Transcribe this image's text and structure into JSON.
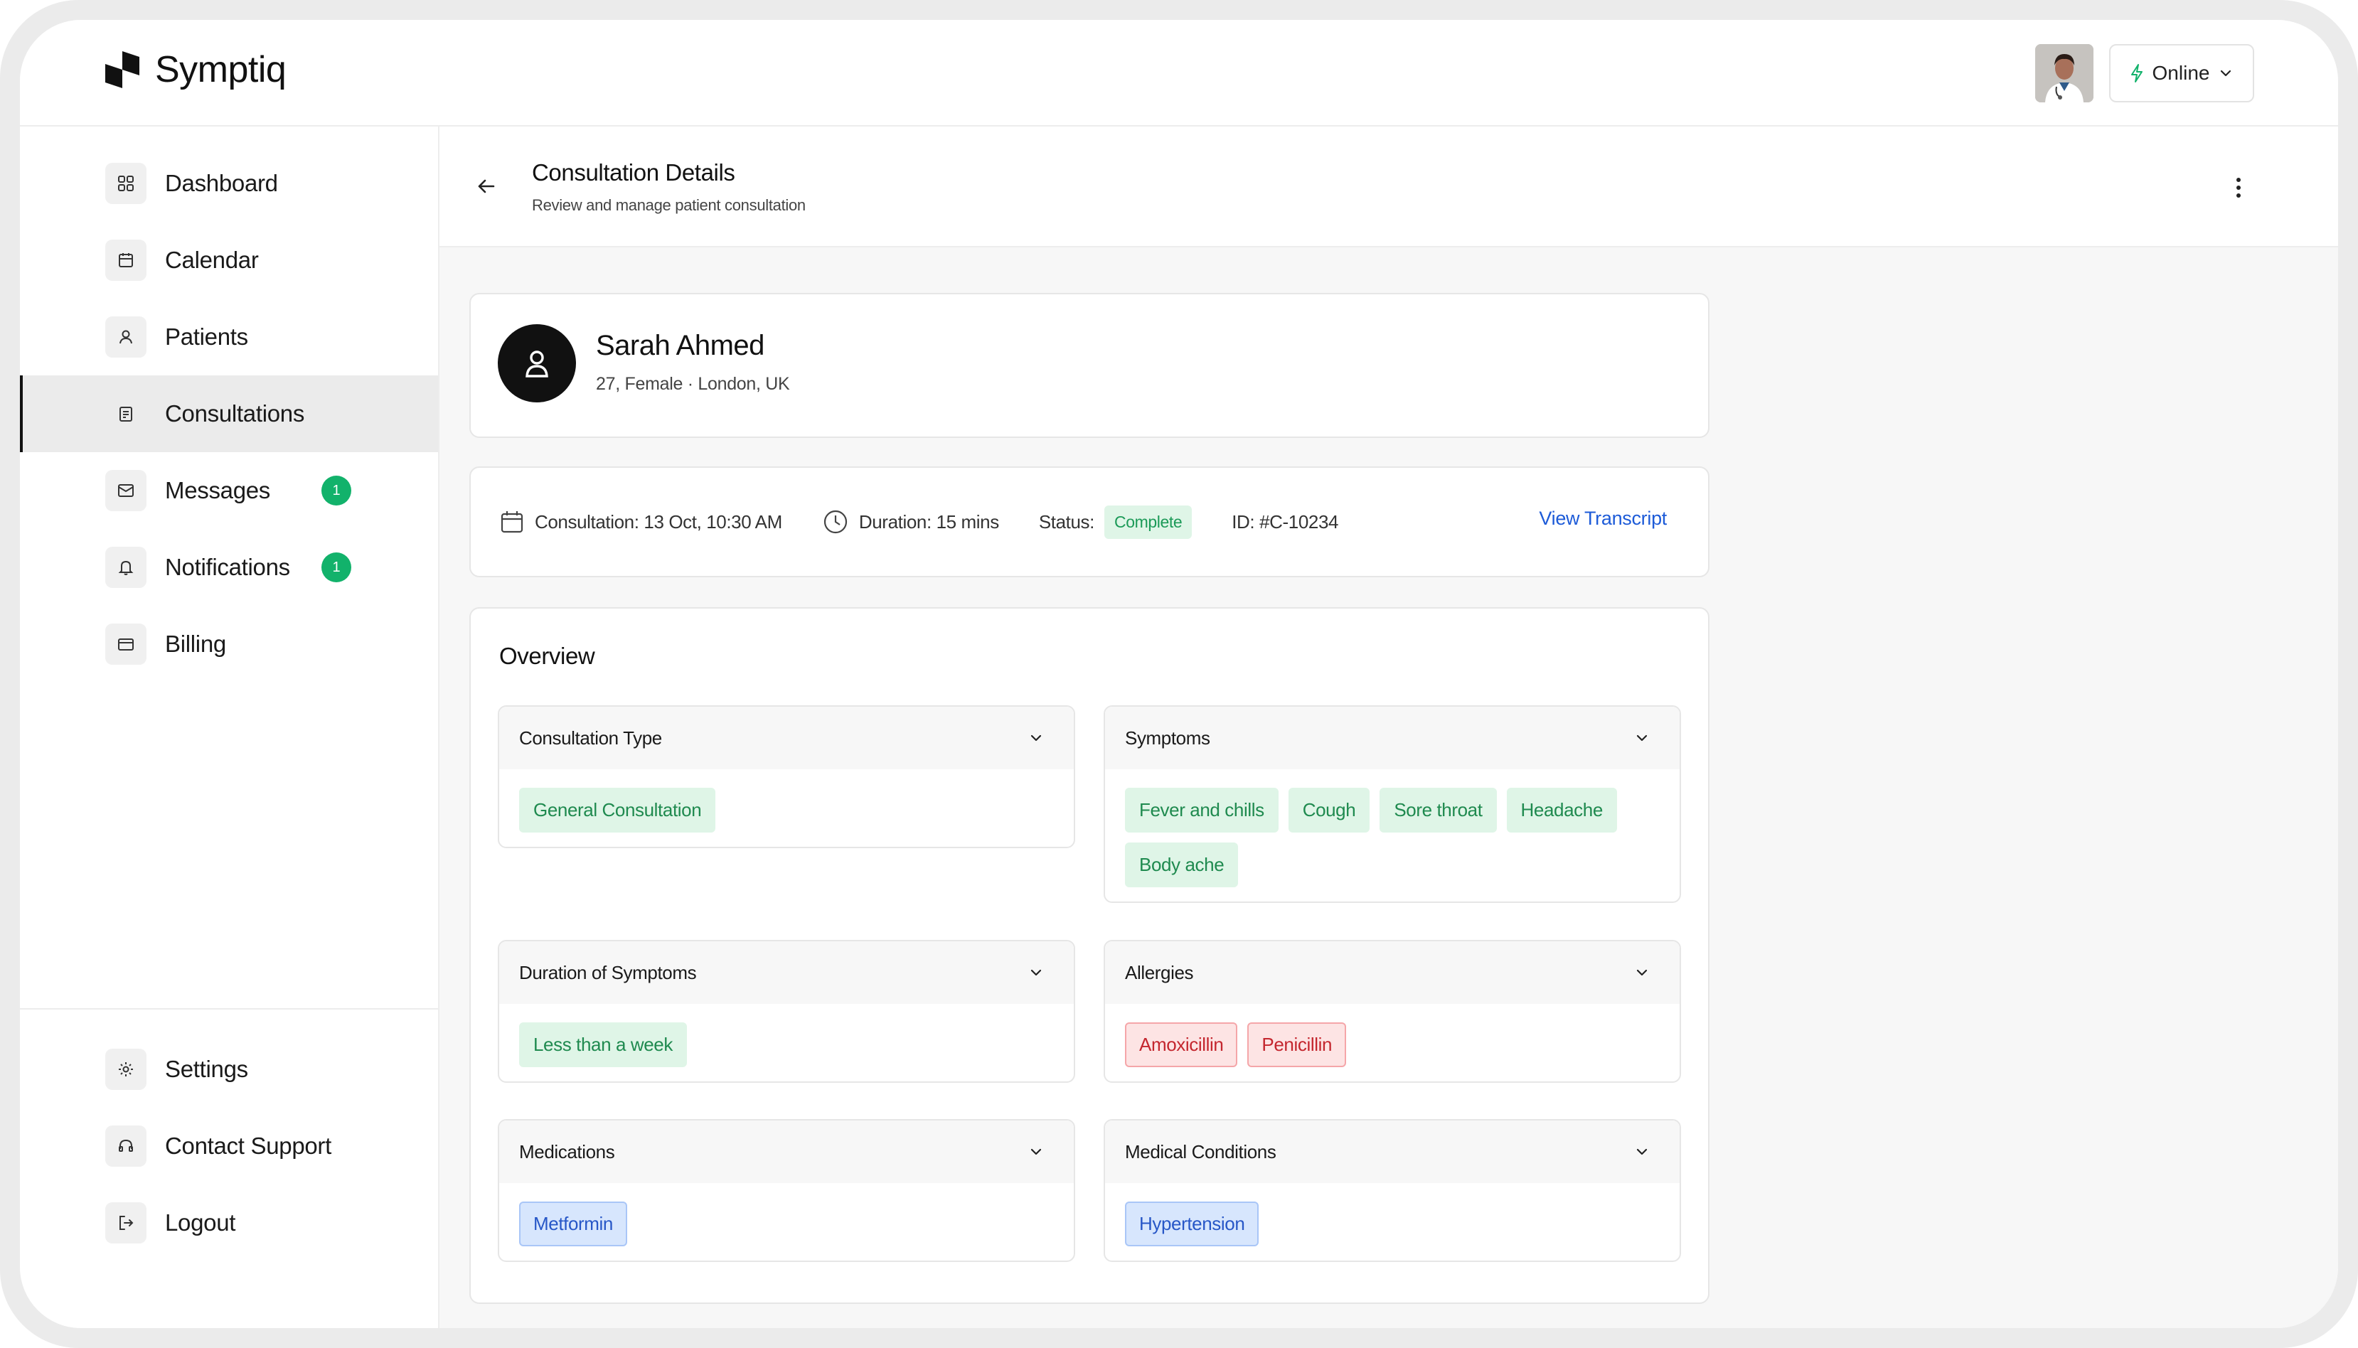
{
  "app": {
    "name": "Symptiq"
  },
  "header": {
    "status_label": "Online"
  },
  "sidebar": {
    "items": [
      {
        "label": "Dashboard",
        "icon": "grid-icon"
      },
      {
        "label": "Calendar",
        "icon": "calendar-icon"
      },
      {
        "label": "Patients",
        "icon": "user-icon"
      },
      {
        "label": "Consultations",
        "icon": "clipboard-icon",
        "active": true
      },
      {
        "label": "Messages",
        "icon": "mail-icon",
        "badge": "1"
      },
      {
        "label": "Notifications",
        "icon": "bell-icon",
        "badge": "1"
      },
      {
        "label": "Billing",
        "icon": "credit-card-icon"
      }
    ],
    "bottom_items": [
      {
        "label": "Settings",
        "icon": "gear-icon"
      },
      {
        "label": "Contact Support",
        "icon": "headset-icon"
      },
      {
        "label": "Logout",
        "icon": "logout-icon"
      }
    ]
  },
  "page": {
    "title": "Consultation Details",
    "subtitle": "Review and manage patient consultation"
  },
  "patient": {
    "name": "Sarah Ahmed",
    "meta": "27, Female · London, UK"
  },
  "consultation": {
    "date_text": "Consultation: 13 Oct, 10:30 AM",
    "duration_text": "Duration: 15 mins",
    "status_label": "Status:",
    "status_value": "Complete",
    "id_text": "ID: #C-10234",
    "transcript_link": "View Transcript"
  },
  "overview": {
    "title": "Overview",
    "panels": [
      {
        "title": "Consultation Type",
        "chips": [
          "General Consultation"
        ],
        "color": "green"
      },
      {
        "title": "Symptoms",
        "chips": [
          "Fever and chills",
          "Cough",
          "Sore throat",
          "Headache",
          "Body ache"
        ],
        "color": "green"
      },
      {
        "title": "Duration of Symptoms",
        "chips": [
          "Less than a week"
        ],
        "color": "green"
      },
      {
        "title": "Allergies",
        "chips": [
          "Amoxicillin",
          "Penicillin"
        ],
        "color": "red"
      },
      {
        "title": "Medications",
        "chips": [
          "Metformin"
        ],
        "color": "blue"
      },
      {
        "title": "Medical Conditions",
        "chips": [
          "Hypertension"
        ],
        "color": "blue"
      }
    ]
  },
  "colors": {
    "accent_green": "#12b26b",
    "link_blue": "#1d5bd8",
    "allergy_red": "#c4262e"
  }
}
